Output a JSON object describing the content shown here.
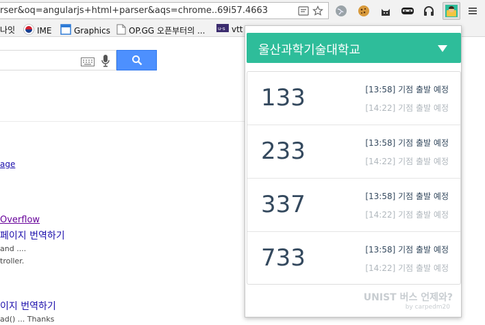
{
  "browser": {
    "url_text": "rser&oq=angularjs+html+parser&aqs=chrome..69i57.4663",
    "bookmarks": [
      {
        "label": "나잇",
        "icon": "bookmark-icon"
      },
      {
        "label": "IME",
        "icon": "korea-flag-icon"
      },
      {
        "label": "Graphics",
        "icon": "graphics-icon"
      },
      {
        "label": "OP.GG 오픈부터의 ...",
        "icon": "page-icon"
      },
      {
        "label": "vtt",
        "icon": "us-icon"
      }
    ],
    "extensions": [
      "globe-icon",
      "cookie-icon",
      "cat-icon",
      "mask-icon",
      "headphones-icon",
      "bus-extension-icon",
      "menu-icon"
    ]
  },
  "page": {
    "results": [
      {
        "kind": "link",
        "text": "age"
      },
      {
        "kind": "visited",
        "text": "Overflow"
      },
      {
        "kind": "title",
        "text": "페이지 번역하기"
      },
      {
        "kind": "snippet",
        "text": "and ...."
      },
      {
        "kind": "snippet",
        "text": "troller."
      },
      {
        "kind": "title",
        "text": "이지 번역하기"
      },
      {
        "kind": "snippet",
        "text": "ad() ... Thanks"
      }
    ]
  },
  "popup": {
    "title": "울산과학기술대학교",
    "routes": [
      {
        "number": "133",
        "time1": "[13:58] 기점 출발 예정",
        "time2": "[14:22] 기점 출발 예정"
      },
      {
        "number": "233",
        "time1": "[13:58] 기점 출발 예정",
        "time2": "[14:22] 기점 출발 예정"
      },
      {
        "number": "337",
        "time1": "[13:58] 기점 출발 예정",
        "time2": "[14:22] 기점 출발 예정"
      },
      {
        "number": "733",
        "time1": "[13:58] 기점 출발 예정",
        "time2": "[14:22] 기점 출발 예정"
      }
    ],
    "footer_title": "UNIST 버스 언제와?",
    "footer_by": "by carpedm20",
    "colors": {
      "header": "#2ebd9a",
      "route_text": "#34495e",
      "muted": "#b0b7bd"
    }
  }
}
